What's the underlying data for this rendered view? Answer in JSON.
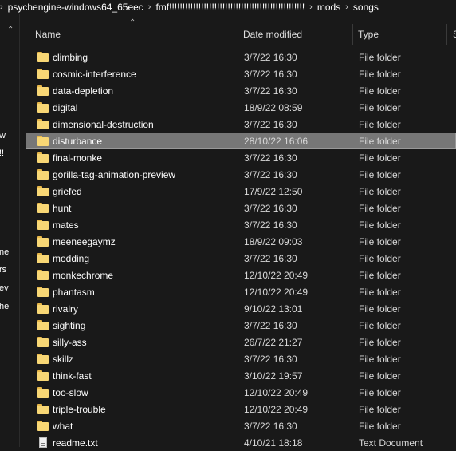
{
  "breadcrumb": {
    "items": [
      "psychengine-windows64_65eec",
      "fmf!!!!!!!!!!!!!!!!!!!!!!!!!!!!!!!!!!!!!!!!!!!!!!!!!!!",
      "mods",
      "songs"
    ],
    "separator": "›"
  },
  "left_pane": {
    "expand_icon": "chevron-up-icon",
    "fragments": [
      "w",
      "!!",
      "ne",
      "rs",
      "ev",
      "he"
    ]
  },
  "columns": {
    "name": "Name",
    "date": "Date modified",
    "type": "Type",
    "size": "S"
  },
  "files": [
    {
      "name": "climbing",
      "date": "3/7/22 16:30",
      "type": "File folder",
      "icon": "folder-icon"
    },
    {
      "name": "cosmic-interference",
      "date": "3/7/22 16:30",
      "type": "File folder",
      "icon": "folder-icon"
    },
    {
      "name": "data-depletion",
      "date": "3/7/22 16:30",
      "type": "File folder",
      "icon": "folder-icon"
    },
    {
      "name": "digital",
      "date": "18/9/22 08:59",
      "type": "File folder",
      "icon": "folder-icon"
    },
    {
      "name": "dimensional-destruction",
      "date": "3/7/22 16:30",
      "type": "File folder",
      "icon": "folder-icon"
    },
    {
      "name": "disturbance",
      "date": "28/10/22 16:06",
      "type": "File folder",
      "icon": "folder-icon",
      "selected": true
    },
    {
      "name": "final-monke",
      "date": "3/7/22 16:30",
      "type": "File folder",
      "icon": "folder-icon"
    },
    {
      "name": "gorilla-tag-animation-preview",
      "date": "3/7/22 16:30",
      "type": "File folder",
      "icon": "folder-icon"
    },
    {
      "name": "griefed",
      "date": "17/9/22 12:50",
      "type": "File folder",
      "icon": "folder-icon"
    },
    {
      "name": "hunt",
      "date": "3/7/22 16:30",
      "type": "File folder",
      "icon": "folder-icon"
    },
    {
      "name": "mates",
      "date": "3/7/22 16:30",
      "type": "File folder",
      "icon": "folder-icon"
    },
    {
      "name": "meeneegaymz",
      "date": "18/9/22 09:03",
      "type": "File folder",
      "icon": "folder-icon"
    },
    {
      "name": "modding",
      "date": "3/7/22 16:30",
      "type": "File folder",
      "icon": "folder-icon"
    },
    {
      "name": "monkechrome",
      "date": "12/10/22 20:49",
      "type": "File folder",
      "icon": "folder-icon"
    },
    {
      "name": "phantasm",
      "date": "12/10/22 20:49",
      "type": "File folder",
      "icon": "folder-icon"
    },
    {
      "name": "rivalry",
      "date": "9/10/22 13:01",
      "type": "File folder",
      "icon": "folder-icon"
    },
    {
      "name": "sighting",
      "date": "3/7/22 16:30",
      "type": "File folder",
      "icon": "folder-icon"
    },
    {
      "name": "silly-ass",
      "date": "26/7/22 21:27",
      "type": "File folder",
      "icon": "folder-icon"
    },
    {
      "name": "skillz",
      "date": "3/7/22 16:30",
      "type": "File folder",
      "icon": "folder-icon"
    },
    {
      "name": "think-fast",
      "date": "3/10/22 19:57",
      "type": "File folder",
      "icon": "folder-icon"
    },
    {
      "name": "too-slow",
      "date": "12/10/22 20:49",
      "type": "File folder",
      "icon": "folder-icon"
    },
    {
      "name": "triple-trouble",
      "date": "12/10/22 20:49",
      "type": "File folder",
      "icon": "folder-icon"
    },
    {
      "name": "what",
      "date": "3/7/22 16:30",
      "type": "File folder",
      "icon": "folder-icon"
    },
    {
      "name": "readme.txt",
      "date": "4/10/21 18:18",
      "type": "Text Document",
      "icon": "text-document-icon"
    }
  ],
  "colors": {
    "background": "#191919",
    "selection": "#777777",
    "folder": "#f8d775"
  }
}
